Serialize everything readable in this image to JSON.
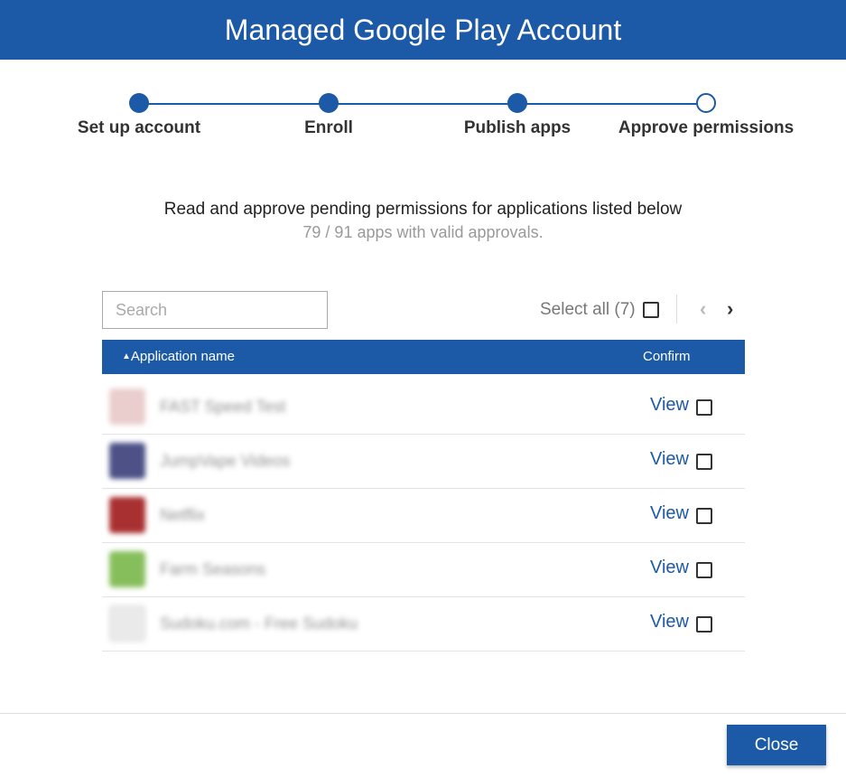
{
  "header": {
    "title": "Managed Google Play Account"
  },
  "stepper": {
    "steps": [
      {
        "label": "Set up account",
        "completed": true
      },
      {
        "label": "Enroll",
        "completed": true
      },
      {
        "label": "Publish apps",
        "completed": true
      },
      {
        "label": "Approve permissions",
        "completed": false
      }
    ]
  },
  "intro": {
    "title": "Read and approve pending permissions for applications listed below",
    "subtitle": "79 / 91 apps with valid approvals."
  },
  "search": {
    "placeholder": "Search",
    "value": ""
  },
  "select_all": {
    "label": "Select all (7)",
    "checked": false
  },
  "pager": {
    "prev_icon": "chevron-left-icon",
    "next_icon": "chevron-right-icon"
  },
  "table": {
    "columns": {
      "name": "Application name",
      "confirm": "Confirm"
    },
    "sort_icon": "sort-up-icon",
    "rows": [
      {
        "name": "FAST Speed Test",
        "action": "View",
        "checked": false,
        "icon_color": "#e8c8c8"
      },
      {
        "name": "JumpVape Videos",
        "action": "View",
        "checked": false,
        "icon_color": "#3a3f7a"
      },
      {
        "name": "Netflix",
        "action": "View",
        "checked": false,
        "icon_color": "#a01a1a"
      },
      {
        "name": "Farm Seasons",
        "action": "View",
        "checked": false,
        "icon_color": "#7ab84a"
      },
      {
        "name": "Sudoku.com - Free Sudoku",
        "action": "View",
        "checked": false,
        "icon_color": "#e8e8e8"
      }
    ]
  },
  "footer": {
    "close_label": "Close"
  },
  "colors": {
    "brand": "#1c5aa8"
  }
}
